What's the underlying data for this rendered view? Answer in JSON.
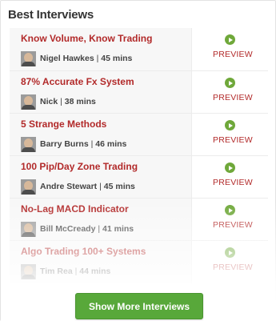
{
  "panel": {
    "title": "Best Interviews",
    "more_button_label": "Show More Interviews"
  },
  "accent_colors": {
    "title_red": "#b22a2a",
    "play_green": "#6fa83a",
    "button_green": "#58a83a"
  },
  "interviews": [
    {
      "title": "Know Volume, Know Trading",
      "author": "Nigel Hawkes",
      "separator": "|",
      "duration": "45 mins",
      "action": "PREVIEW",
      "icon": "play-icon"
    },
    {
      "title": "87% Accurate Fx System",
      "author": "Nick",
      "separator": "|",
      "duration": "38 mins",
      "action": "PREVIEW",
      "icon": "play-icon"
    },
    {
      "title": "5 Strange Methods",
      "author": "Barry Burns",
      "separator": "|",
      "duration": "46 mins",
      "action": "PREVIEW",
      "icon": "play-icon"
    },
    {
      "title": "100 Pip/Day Zone Trading",
      "author": "Andre Stewart",
      "separator": "|",
      "duration": "45 mins",
      "action": "PREVIEW",
      "icon": "play-icon"
    },
    {
      "title": "No-Lag MACD Indicator",
      "author": "Bill McCready",
      "separator": "|",
      "duration": "41 mins",
      "action": "PREVIEW",
      "icon": "play-icon"
    },
    {
      "title": "Algo Trading 100+ Systems",
      "author": "Tim Rea",
      "separator": "|",
      "duration": "44 mins",
      "action": "PREVIEW",
      "icon": "play-icon"
    }
  ]
}
